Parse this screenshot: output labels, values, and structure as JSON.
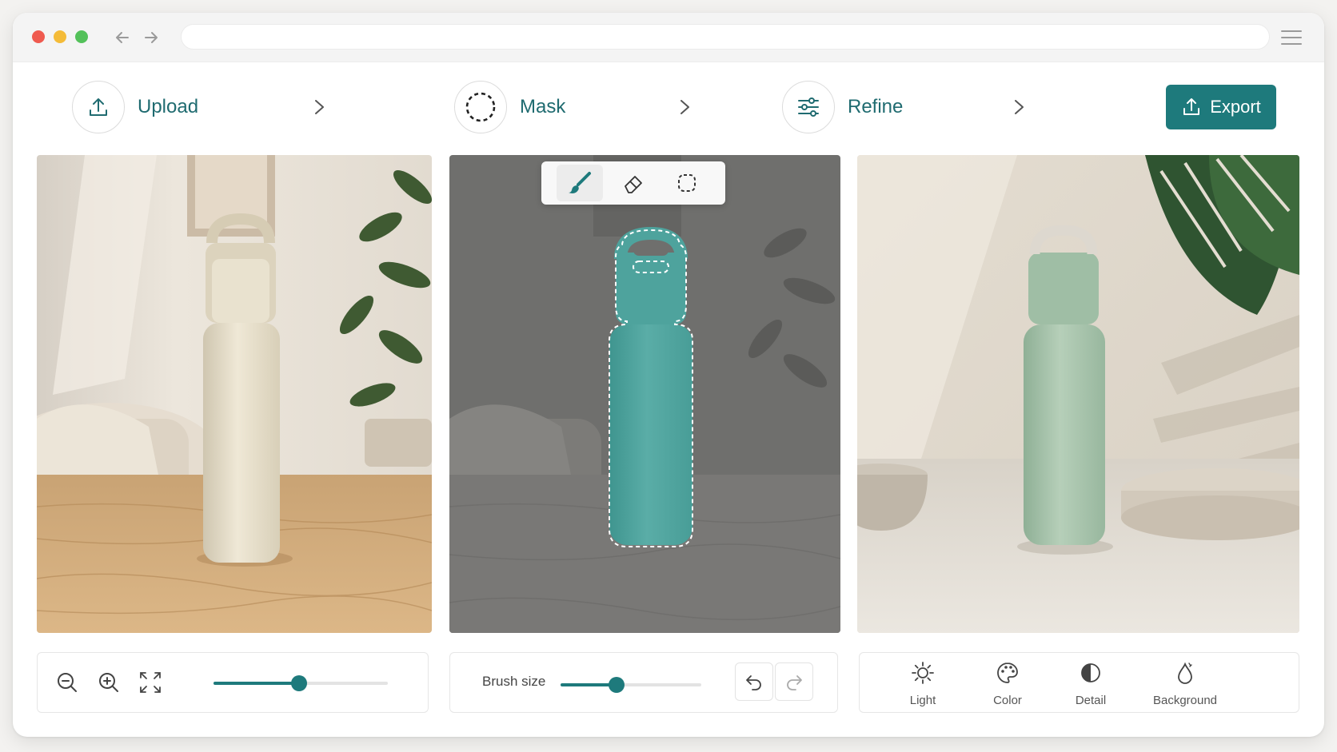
{
  "steps": [
    {
      "label": "Upload",
      "icon": "upload-icon"
    },
    {
      "label": "Mask",
      "icon": "dashed-circle-icon"
    },
    {
      "label": "Refine",
      "icon": "sliders-icon"
    }
  ],
  "export": {
    "label": "Export",
    "icon": "export-icon"
  },
  "mask_tools": [
    {
      "name": "brush",
      "icon": "brush-icon",
      "active": true
    },
    {
      "name": "eraser",
      "icon": "eraser-icon",
      "active": false
    },
    {
      "name": "lasso",
      "icon": "lasso-select-icon",
      "active": false
    }
  ],
  "zoom_controls": {
    "icons": [
      "zoom-out-icon",
      "zoom-in-icon",
      "fit-screen-icon"
    ],
    "zoom_level": 0.49
  },
  "brush": {
    "label": "Brush size",
    "level": 0.4
  },
  "history": {
    "icons": [
      "undo-icon",
      "redo-icon"
    ]
  },
  "adjustments": [
    {
      "label": "Light",
      "icon": "sun-icon"
    },
    {
      "label": "Color",
      "icon": "palette-icon"
    },
    {
      "label": "Detail",
      "icon": "contrast-icon"
    },
    {
      "label": "Background",
      "icon": "droplet-icon"
    }
  ],
  "colors": {
    "accent": "#1e7a7c",
    "original_bottle": "#e7dfcc",
    "mask_bottle": "#4ea39d",
    "refined_bottle": "#a9c7ad"
  }
}
